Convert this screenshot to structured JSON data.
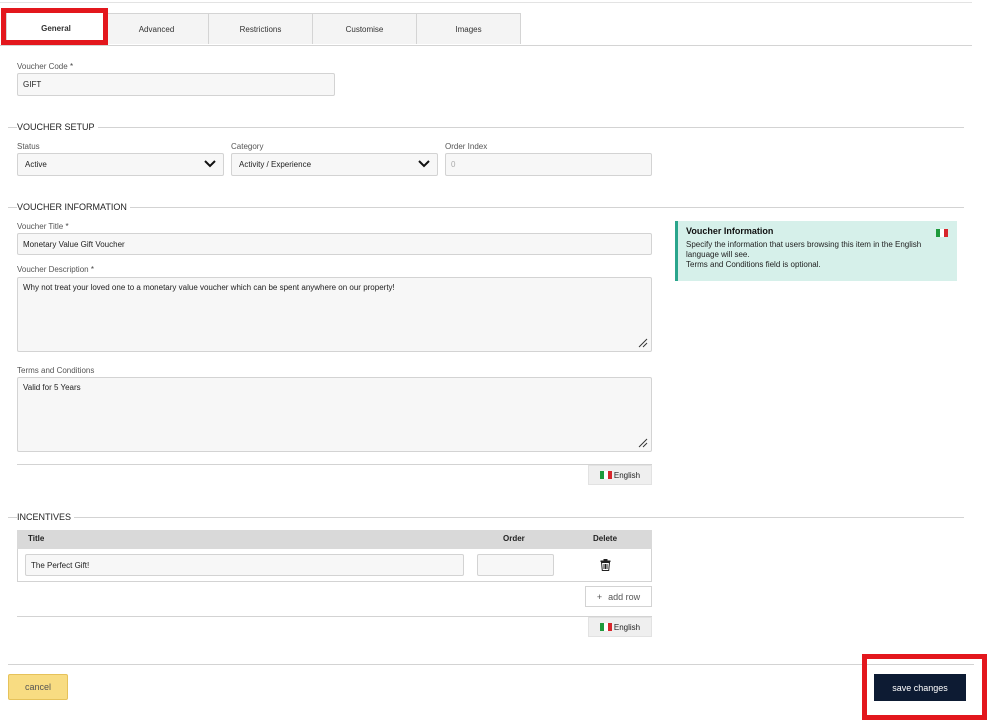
{
  "tabs": [
    {
      "label": "General",
      "active": true
    },
    {
      "label": "Advanced"
    },
    {
      "label": "Restrictions"
    },
    {
      "label": "Customise"
    },
    {
      "label": "Images"
    }
  ],
  "voucher_code": {
    "label": "Voucher Code",
    "required_mark": "*",
    "value": "GIFT"
  },
  "voucher_setup": {
    "title": "VOUCHER SETUP",
    "status": {
      "label": "Status",
      "value": "Active"
    },
    "category": {
      "label": "Category",
      "value": "Activity / Experience"
    },
    "order_index": {
      "label": "Order Index",
      "placeholder": "0"
    }
  },
  "voucher_information": {
    "title": "VOUCHER INFORMATION",
    "voucher_title": {
      "label": "Voucher Title",
      "required_mark": "*",
      "value": "Monetary Value Gift Voucher"
    },
    "voucher_description": {
      "label": "Voucher Description",
      "required_mark": "*",
      "value": "Why not treat your loved one to a monetary value voucher which can be spent anywhere on our property!"
    },
    "terms": {
      "label": "Terms and Conditions",
      "value": "Valid for 5 Years"
    },
    "language_button": "English"
  },
  "info_box": {
    "title": "Voucher Information",
    "line1": "Specify the information that users browsing this item in the English language will see.",
    "line2": "Terms and Conditions field is optional."
  },
  "incentives": {
    "title": "INCENTIVES",
    "columns": {
      "title": "Title",
      "order": "Order",
      "delete": "Delete"
    },
    "rows": [
      {
        "title": "The Perfect Gift!",
        "order": ""
      }
    ],
    "add_row": "add row",
    "language_button": "English"
  },
  "actions": {
    "cancel": "cancel",
    "save": "save changes"
  },
  "colors": {
    "highlight": "#e3171d",
    "save_bg": "#0d1b33",
    "cancel_bg": "#f8dc82",
    "info_bg": "#d6f0ea"
  }
}
